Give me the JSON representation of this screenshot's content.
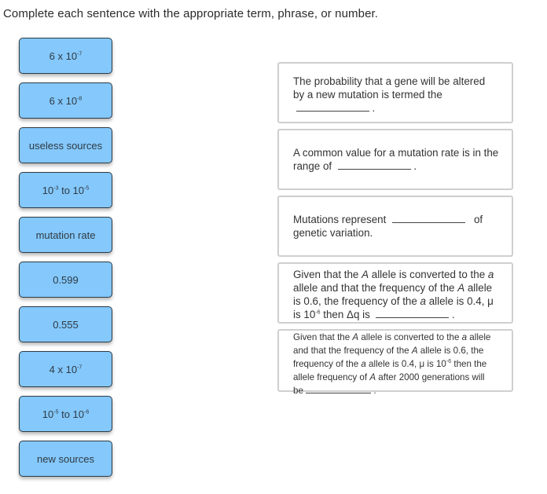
{
  "instructions": "Complete each sentence with the appropriate term, phrase, or number.",
  "tiles": [
    {
      "base": "6 x 10",
      "sup": "-7",
      "after": ""
    },
    {
      "base": "6 x 10",
      "sup": "-8",
      "after": ""
    },
    {
      "base": "useless sources",
      "sup": "",
      "after": ""
    },
    {
      "base": "10",
      "sup": "-3",
      "after": " to 10",
      "sup2": "-5"
    },
    {
      "base": "mutation rate",
      "sup": "",
      "after": ""
    },
    {
      "base": "0.599",
      "sup": "",
      "after": ""
    },
    {
      "base": "0.555",
      "sup": "",
      "after": ""
    },
    {
      "base": "4 x 10",
      "sup": "-7",
      "after": ""
    },
    {
      "base": "10",
      "sup": "-5",
      "after": " to 10",
      "sup2": "-6"
    },
    {
      "base": "new sources",
      "sup": "",
      "after": ""
    }
  ],
  "targets": {
    "t1": {
      "text1": "The probability that a gene will be altered by a new mutation is termed the",
      "end": "."
    },
    "t2": {
      "text1": "A common value for a mutation rate is in the range of",
      "end": "."
    },
    "t3": {
      "text1": "Mutations represent",
      "text2": "of genetic variation."
    },
    "t4": {
      "p1": "Given that the ",
      "A1": "A",
      "p2": " allele is converted to the ",
      "a1": "a",
      "p3": " allele and that the frequency of the ",
      "A2": "A",
      "p4": " allele is 0.6, the frequency of the ",
      "a2": "a",
      "p5": " allele is 0.4, μ is  10",
      "sup": "-6",
      "p6": " then Δq is",
      "end": "."
    },
    "t5": {
      "p1": "Given that the ",
      "A1": "A",
      "p2": " allele is converted to the ",
      "a1": "a",
      "p3": " allele and that the frequency of the ",
      "A2": "A",
      "p4": " allele is 0.6, the frequency of the ",
      "a2": "a",
      "p5": " allele is 0.4, μ is 10",
      "sup": "-6",
      "p6": " then the allele frequency of ",
      "A3": "A",
      "p7": " after 2000 generations will be",
      "end": "."
    }
  }
}
